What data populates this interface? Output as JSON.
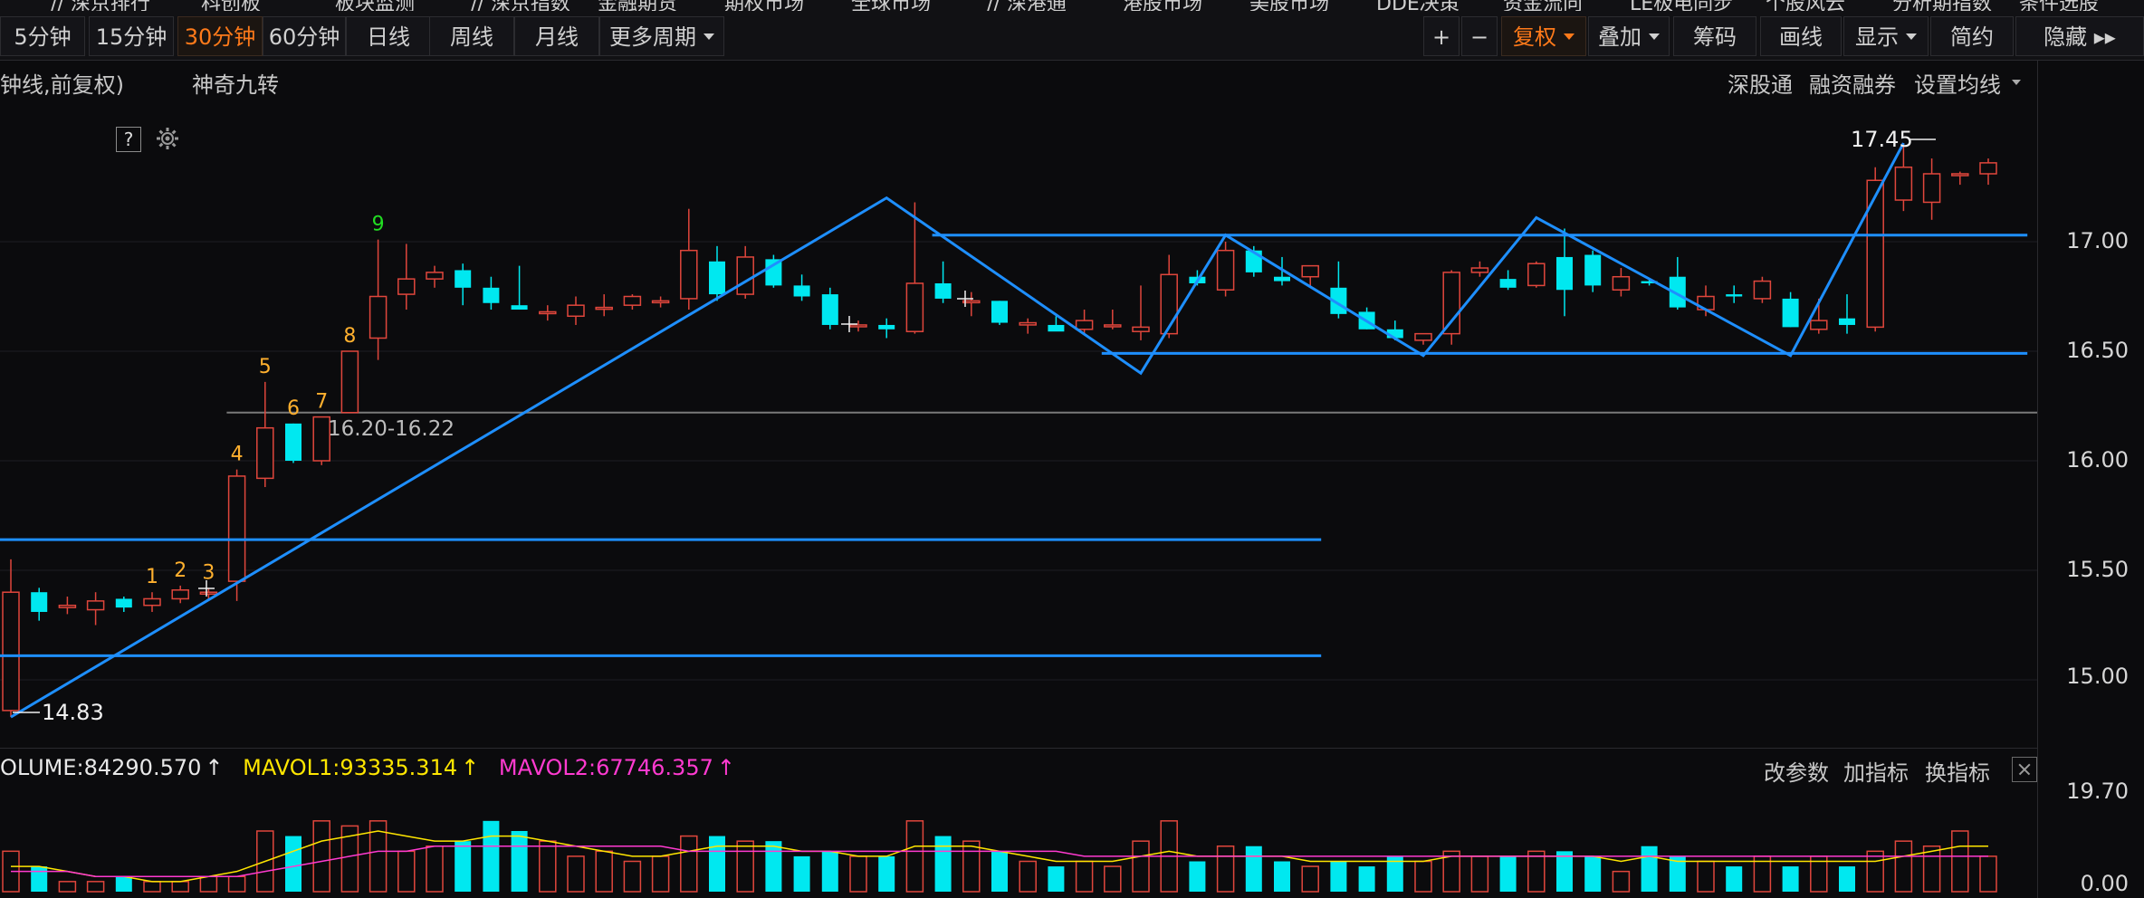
{
  "top_cut_items": [
    "// 深京排行",
    "科创板",
    "板块监测",
    "// 深京指数",
    "金融期货",
    "期权市场",
    "全球市场",
    "// 深港通",
    "港股市场",
    "美股市场",
    "DDE决策",
    "资金流向",
    "LE极电同步",
    "个股风云",
    "分析期指数",
    "条件选股"
  ],
  "period_tabs": [
    {
      "label": "5分钟",
      "active": false
    },
    {
      "label": "15分钟",
      "active": false
    },
    {
      "label": "30分钟",
      "active": true
    },
    {
      "label": "60分钟",
      "active": false
    },
    {
      "label": "日线",
      "active": false
    },
    {
      "label": "周线",
      "active": false
    },
    {
      "label": "月线",
      "active": false
    },
    {
      "label": "更多周期",
      "active": false,
      "dropdown": true
    }
  ],
  "right_tools": [
    {
      "label": "+",
      "kind": "zoom-in"
    },
    {
      "label": "−",
      "kind": "zoom-out"
    },
    {
      "label": "复权",
      "active": true,
      "dropdown": true
    },
    {
      "label": "叠加",
      "dropdown": true
    },
    {
      "label": "筹码"
    },
    {
      "label": "画线"
    },
    {
      "label": "显示",
      "dropdown": true
    },
    {
      "label": "简约"
    },
    {
      "label": "隐藏 ▸▸"
    }
  ],
  "subbar": {
    "period_note": "钟线,前复权)",
    "help": "?",
    "indicator": "神奇九转",
    "links": [
      "深股通",
      "融资融券",
      "设置均线"
    ]
  },
  "price_axis": {
    "labels": [
      "17.00",
      "16.50",
      "16.00",
      "15.50",
      "15.00"
    ],
    "values": [
      17.0,
      16.5,
      16.0,
      15.5,
      15.0
    ]
  },
  "vol_axis": {
    "labels": [
      "19.70",
      "0.00"
    ]
  },
  "annotations": {
    "high": "17.45",
    "low": "14.83",
    "range": "16.20-16.22"
  },
  "nine_turn": [
    "1",
    "2",
    "3",
    "4",
    "5",
    "6",
    "7",
    "8",
    "9"
  ],
  "volume_legend": {
    "volume": "OLUME:84290.570",
    "mavol1": "MAVOL1:93335.314",
    "mavol2": "MAVOL2:67746.357"
  },
  "volume_tools": [
    "改参数",
    "加指标",
    "换指标"
  ],
  "colors": {
    "up": "#e0463c",
    "down": "#00e8f0",
    "line": "#1e8fff",
    "mavol1": "#ffe600",
    "mavol2": "#ff3ad0",
    "accent": "#ff7a1a"
  },
  "chart_data": {
    "type": "candlestick",
    "ylim": [
      14.75,
      17.55
    ],
    "candles": [
      {
        "o": 14.86,
        "h": 15.55,
        "l": 14.83,
        "c": 15.4
      },
      {
        "o": 15.4,
        "h": 15.42,
        "l": 15.27,
        "c": 15.31
      },
      {
        "o": 15.33,
        "h": 15.38,
        "l": 15.3,
        "c": 15.34
      },
      {
        "o": 15.32,
        "h": 15.4,
        "l": 15.25,
        "c": 15.36
      },
      {
        "o": 15.37,
        "h": 15.38,
        "l": 15.31,
        "c": 15.33
      },
      {
        "o": 15.34,
        "h": 15.4,
        "l": 15.31,
        "c": 15.37
      },
      {
        "o": 15.37,
        "h": 15.43,
        "l": 15.35,
        "c": 15.41
      },
      {
        "o": 15.4,
        "h": 15.42,
        "l": 15.36,
        "c": 15.4
      },
      {
        "o": 15.45,
        "h": 15.96,
        "l": 15.36,
        "c": 15.93
      },
      {
        "o": 15.92,
        "h": 16.36,
        "l": 15.88,
        "c": 16.15
      },
      {
        "o": 16.17,
        "h": 16.17,
        "l": 15.99,
        "c": 16.0
      },
      {
        "o": 16.0,
        "h": 16.2,
        "l": 15.98,
        "c": 16.2
      },
      {
        "o": 16.22,
        "h": 16.5,
        "l": 16.22,
        "c": 16.5
      },
      {
        "o": 16.56,
        "h": 17.01,
        "l": 16.46,
        "c": 16.75
      },
      {
        "o": 16.76,
        "h": 16.99,
        "l": 16.69,
        "c": 16.83
      },
      {
        "o": 16.83,
        "h": 16.89,
        "l": 16.79,
        "c": 16.86
      },
      {
        "o": 16.87,
        "h": 16.9,
        "l": 16.71,
        "c": 16.79
      },
      {
        "o": 16.79,
        "h": 16.84,
        "l": 16.69,
        "c": 16.72
      },
      {
        "o": 16.71,
        "h": 16.89,
        "l": 16.69,
        "c": 16.69
      },
      {
        "o": 16.68,
        "h": 16.71,
        "l": 16.64,
        "c": 16.68
      },
      {
        "o": 16.66,
        "h": 16.75,
        "l": 16.62,
        "c": 16.71
      },
      {
        "o": 16.7,
        "h": 16.76,
        "l": 16.66,
        "c": 16.7
      },
      {
        "o": 16.71,
        "h": 16.76,
        "l": 16.69,
        "c": 16.75
      },
      {
        "o": 16.73,
        "h": 16.75,
        "l": 16.7,
        "c": 16.73
      },
      {
        "o": 16.74,
        "h": 17.15,
        "l": 16.69,
        "c": 16.96
      },
      {
        "o": 16.91,
        "h": 16.98,
        "l": 16.73,
        "c": 16.76
      },
      {
        "o": 16.76,
        "h": 16.98,
        "l": 16.74,
        "c": 16.93
      },
      {
        "o": 16.92,
        "h": 16.94,
        "l": 16.79,
        "c": 16.8
      },
      {
        "o": 16.8,
        "h": 16.85,
        "l": 16.73,
        "c": 16.75
      },
      {
        "o": 16.76,
        "h": 16.79,
        "l": 16.6,
        "c": 16.62
      },
      {
        "o": 16.62,
        "h": 16.64,
        "l": 16.59,
        "c": 16.62
      },
      {
        "o": 16.62,
        "h": 16.65,
        "l": 16.56,
        "c": 16.6
      },
      {
        "o": 16.59,
        "h": 17.18,
        "l": 16.58,
        "c": 16.81
      },
      {
        "o": 16.81,
        "h": 16.91,
        "l": 16.72,
        "c": 16.74
      },
      {
        "o": 16.73,
        "h": 16.77,
        "l": 16.66,
        "c": 16.73
      },
      {
        "o": 16.73,
        "h": 16.73,
        "l": 16.62,
        "c": 16.63
      },
      {
        "o": 16.62,
        "h": 16.65,
        "l": 16.58,
        "c": 16.63
      },
      {
        "o": 16.62,
        "h": 16.66,
        "l": 16.6,
        "c": 16.59
      },
      {
        "o": 16.6,
        "h": 16.69,
        "l": 16.58,
        "c": 16.64
      },
      {
        "o": 16.62,
        "h": 16.69,
        "l": 16.6,
        "c": 16.62
      },
      {
        "o": 16.59,
        "h": 16.8,
        "l": 16.55,
        "c": 16.61
      },
      {
        "o": 16.58,
        "h": 16.94,
        "l": 16.56,
        "c": 16.85
      },
      {
        "o": 16.84,
        "h": 16.87,
        "l": 16.8,
        "c": 16.81
      },
      {
        "o": 16.78,
        "h": 17.0,
        "l": 16.75,
        "c": 16.96
      },
      {
        "o": 16.96,
        "h": 16.98,
        "l": 16.84,
        "c": 16.86
      },
      {
        "o": 16.84,
        "h": 16.93,
        "l": 16.8,
        "c": 16.82
      },
      {
        "o": 16.84,
        "h": 16.89,
        "l": 16.79,
        "c": 16.89
      },
      {
        "o": 16.79,
        "h": 16.91,
        "l": 16.65,
        "c": 16.67
      },
      {
        "o": 16.68,
        "h": 16.7,
        "l": 16.6,
        "c": 16.6
      },
      {
        "o": 16.6,
        "h": 16.64,
        "l": 16.55,
        "c": 16.56
      },
      {
        "o": 16.55,
        "h": 16.58,
        "l": 16.53,
        "c": 16.58
      },
      {
        "o": 16.58,
        "h": 16.87,
        "l": 16.53,
        "c": 16.86
      },
      {
        "o": 16.86,
        "h": 16.91,
        "l": 16.84,
        "c": 16.88
      },
      {
        "o": 16.83,
        "h": 16.87,
        "l": 16.78,
        "c": 16.79
      },
      {
        "o": 16.8,
        "h": 16.91,
        "l": 16.79,
        "c": 16.9
      },
      {
        "o": 16.93,
        "h": 17.06,
        "l": 16.66,
        "c": 16.78
      },
      {
        "o": 16.94,
        "h": 16.96,
        "l": 16.77,
        "c": 16.8
      },
      {
        "o": 16.78,
        "h": 16.88,
        "l": 16.75,
        "c": 16.84
      },
      {
        "o": 16.82,
        "h": 16.83,
        "l": 16.8,
        "c": 16.81
      },
      {
        "o": 16.84,
        "h": 16.93,
        "l": 16.69,
        "c": 16.7
      },
      {
        "o": 16.69,
        "h": 16.8,
        "l": 16.66,
        "c": 16.75
      },
      {
        "o": 16.76,
        "h": 16.8,
        "l": 16.72,
        "c": 16.75
      },
      {
        "o": 16.74,
        "h": 16.84,
        "l": 16.72,
        "c": 16.82
      },
      {
        "o": 16.74,
        "h": 16.77,
        "l": 16.61,
        "c": 16.61
      },
      {
        "o": 16.6,
        "h": 16.74,
        "l": 16.58,
        "c": 16.64
      },
      {
        "o": 16.65,
        "h": 16.76,
        "l": 16.58,
        "c": 16.62
      },
      {
        "o": 16.61,
        "h": 17.34,
        "l": 16.59,
        "c": 17.28
      },
      {
        "o": 17.19,
        "h": 17.45,
        "l": 17.14,
        "c": 17.34
      },
      {
        "o": 17.18,
        "h": 17.38,
        "l": 17.1,
        "c": 17.31
      },
      {
        "o": 17.31,
        "h": 17.32,
        "l": 17.26,
        "c": 17.31
      },
      {
        "o": 17.31,
        "h": 17.38,
        "l": 17.26,
        "c": 17.36
      }
    ],
    "volumes": [
      8,
      5,
      2,
      2,
      3,
      2,
      2,
      3,
      3,
      12,
      11,
      14,
      13,
      14,
      8,
      9,
      10,
      14,
      12,
      10,
      7,
      8,
      6,
      7,
      11,
      11,
      10,
      10,
      7,
      8,
      7,
      7,
      14,
      11,
      10,
      8,
      6,
      5,
      6,
      5,
      10,
      14,
      6,
      9,
      9,
      6,
      5,
      6,
      5,
      7,
      6,
      8,
      7,
      7,
      8,
      8,
      7,
      4,
      9,
      7,
      6,
      5,
      7,
      5,
      7,
      5,
      8,
      10,
      9,
      12,
      7
    ],
    "mavol1": [
      5,
      5,
      4,
      3,
      3,
      2,
      2,
      3,
      4,
      6,
      8,
      10,
      11,
      12,
      11,
      10,
      10,
      11,
      11,
      10,
      9,
      8,
      7,
      7,
      8,
      9,
      9,
      9,
      8,
      8,
      7,
      7,
      9,
      9,
      9,
      8,
      7,
      6,
      6,
      6,
      7,
      8,
      7,
      7,
      7,
      7,
      6,
      6,
      6,
      6,
      6,
      7,
      7,
      7,
      7,
      7,
      7,
      6,
      7,
      6,
      6,
      6,
      6,
      6,
      6,
      6,
      6,
      7,
      8,
      9,
      9
    ],
    "mavol2": [
      4,
      4,
      4,
      3,
      3,
      3,
      3,
      3,
      3,
      4,
      5,
      6,
      7,
      8,
      8,
      9,
      9,
      9,
      9,
      9,
      9,
      9,
      9,
      9,
      8,
      8,
      8,
      8,
      8,
      8,
      8,
      8,
      8,
      8,
      8,
      8,
      8,
      8,
      7,
      7,
      7,
      7,
      7,
      7,
      7,
      7,
      7,
      7,
      7,
      7,
      7,
      7,
      7,
      7,
      7,
      7,
      7,
      7,
      7,
      7,
      7,
      7,
      7,
      7,
      7,
      7,
      7,
      7,
      7,
      7,
      7
    ],
    "volume_max": 19.7,
    "zigzag": [
      {
        "i": 0,
        "p": 14.83
      },
      {
        "i": 31,
        "p": 17.2
      },
      {
        "i": 40,
        "p": 16.4
      },
      {
        "i": 43,
        "p": 17.03
      },
      {
        "i": 50,
        "p": 16.48
      },
      {
        "i": 54,
        "p": 17.11
      },
      {
        "i": 63,
        "p": 16.48
      },
      {
        "i": 67,
        "p": 17.45
      }
    ],
    "hlines": [
      {
        "p": 17.03,
        "from": 33,
        "to": 71
      },
      {
        "p": 16.49,
        "from": 39,
        "to": 71
      },
      {
        "p": 15.64,
        "from": 0,
        "to": 46
      },
      {
        "p": 15.11,
        "from": 0,
        "to": 46
      }
    ],
    "support_line": 16.22
  }
}
